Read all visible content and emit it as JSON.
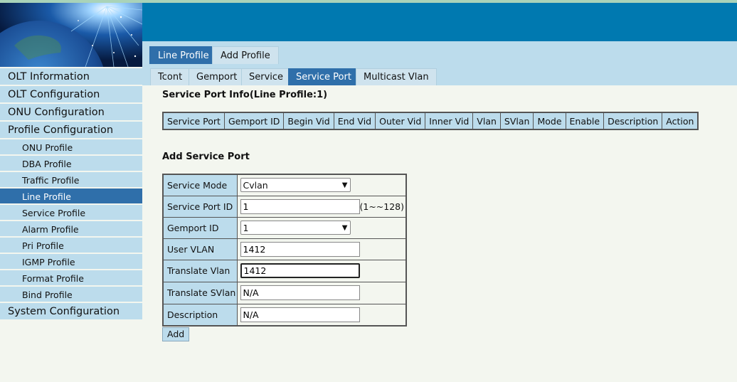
{
  "sidebar": {
    "items": [
      {
        "label": "OLT Information",
        "level": "top"
      },
      {
        "label": "OLT Configuration",
        "level": "top"
      },
      {
        "label": "ONU Configuration",
        "level": "top"
      },
      {
        "label": "Profile Configuration",
        "level": "top"
      },
      {
        "label": "ONU Profile",
        "level": "sub"
      },
      {
        "label": "DBA Profile",
        "level": "sub"
      },
      {
        "label": "Traffic Profile",
        "level": "sub"
      },
      {
        "label": "Line Profile",
        "level": "sub",
        "active": true
      },
      {
        "label": "Service Profile",
        "level": "sub"
      },
      {
        "label": "Alarm Profile",
        "level": "sub"
      },
      {
        "label": "Pri Profile",
        "level": "sub"
      },
      {
        "label": "IGMP Profile",
        "level": "sub"
      },
      {
        "label": "Format Profile",
        "level": "sub"
      },
      {
        "label": "Bind Profile",
        "level": "sub"
      },
      {
        "label": "System Configuration",
        "level": "top"
      }
    ]
  },
  "top_tabs": {
    "line_profile": "Line Profile",
    "add_profile": "Add Profile"
  },
  "sub_tabs": {
    "tcont": "Tcont",
    "gemport": "Gemport",
    "service": "Service",
    "service_port": "Service Port",
    "multicast_vlan": "Multicast Vlan"
  },
  "info": {
    "title": "Service Port Info(Line Profile:1)",
    "columns": [
      "Service Port",
      "Gemport ID",
      "Begin Vid",
      "End Vid",
      "Outer Vid",
      "Inner Vid",
      "Vlan",
      "SVlan",
      "Mode",
      "Enable",
      "Description",
      "Action"
    ]
  },
  "form": {
    "title": "Add Service Port",
    "service_mode_label": "Service Mode",
    "service_mode_value": "Cvlan",
    "service_port_id_label": "Service Port ID",
    "service_port_id_value": "1",
    "service_port_id_hint": "(1~~128)",
    "gemport_id_label": "Gemport ID",
    "gemport_id_value": "1",
    "user_vlan_label": "User VLAN",
    "user_vlan_value": "1412",
    "translate_vlan_label": "Translate Vlan",
    "translate_vlan_value": "1412",
    "translate_svlan_label": "Translate SVlan",
    "translate_svlan_value": "N/A",
    "description_label": "Description",
    "description_value": "N/A",
    "add_button": "Add"
  },
  "colors": {
    "banner": "#0079b0",
    "panel": "#bcdcec",
    "active": "#2f6faa",
    "background": "#f3f6ef"
  }
}
